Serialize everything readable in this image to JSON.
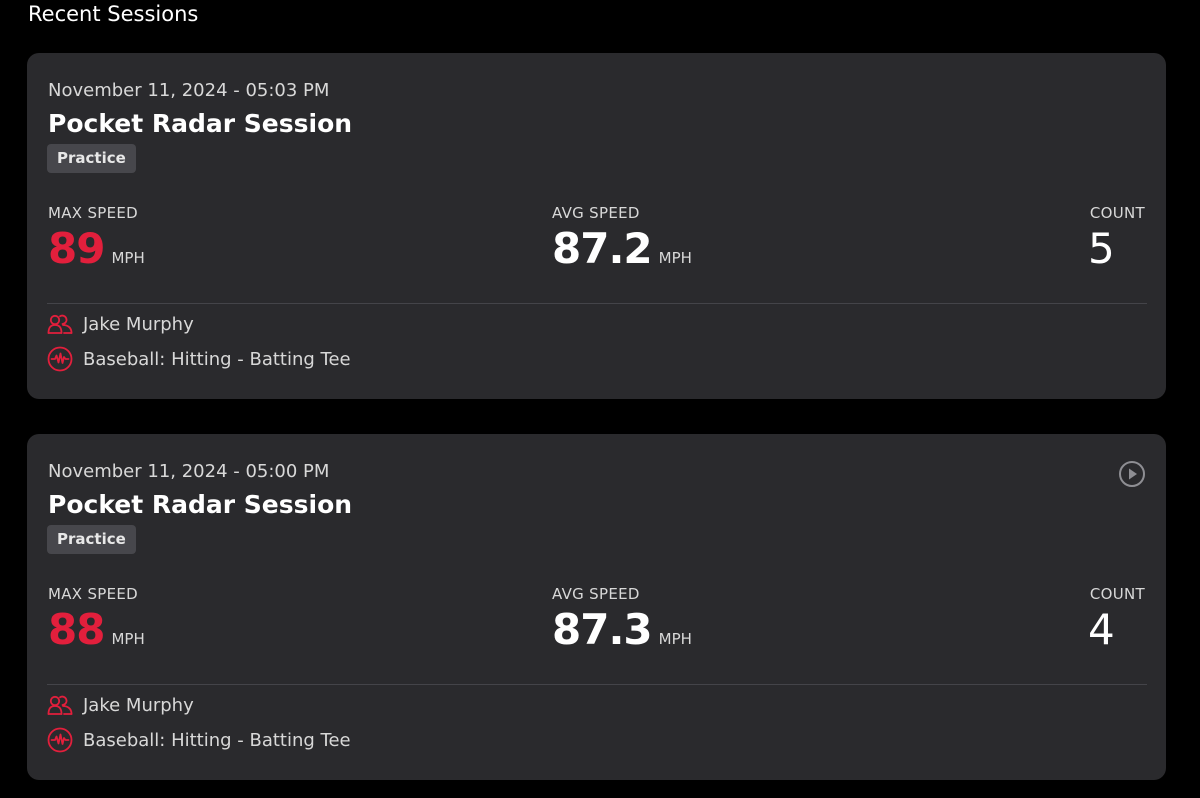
{
  "section_title": "Recent Sessions",
  "accent_color": "#e21f3c",
  "sessions": [
    {
      "date": "November 11, 2024 - 05:03 PM",
      "title": "Pocket Radar Session",
      "tag": "Practice",
      "max_speed_label": "MAX SPEED",
      "max_speed": "89",
      "max_speed_unit": "MPH",
      "avg_speed_label": "AVG SPEED",
      "avg_speed": "87.2",
      "avg_speed_unit": "MPH",
      "count_label": "COUNT",
      "count": "5",
      "athlete": "Jake Murphy",
      "athlete_icon": "athletes-icon",
      "activity": "Baseball: Hitting - Batting Tee",
      "activity_icon": "activity-pulse-icon",
      "has_video": false
    },
    {
      "date": "November 11, 2024 - 05:00 PM",
      "title": "Pocket Radar Session",
      "tag": "Practice",
      "max_speed_label": "MAX SPEED",
      "max_speed": "88",
      "max_speed_unit": "MPH",
      "avg_speed_label": "AVG SPEED",
      "avg_speed": "87.3",
      "avg_speed_unit": "MPH",
      "count_label": "COUNT",
      "count": "4",
      "athlete": "Jake Murphy",
      "athlete_icon": "athletes-icon",
      "activity": "Baseball: Hitting - Batting Tee",
      "activity_icon": "activity-pulse-icon",
      "has_video": true,
      "video_icon": "play-circle-icon"
    }
  ]
}
